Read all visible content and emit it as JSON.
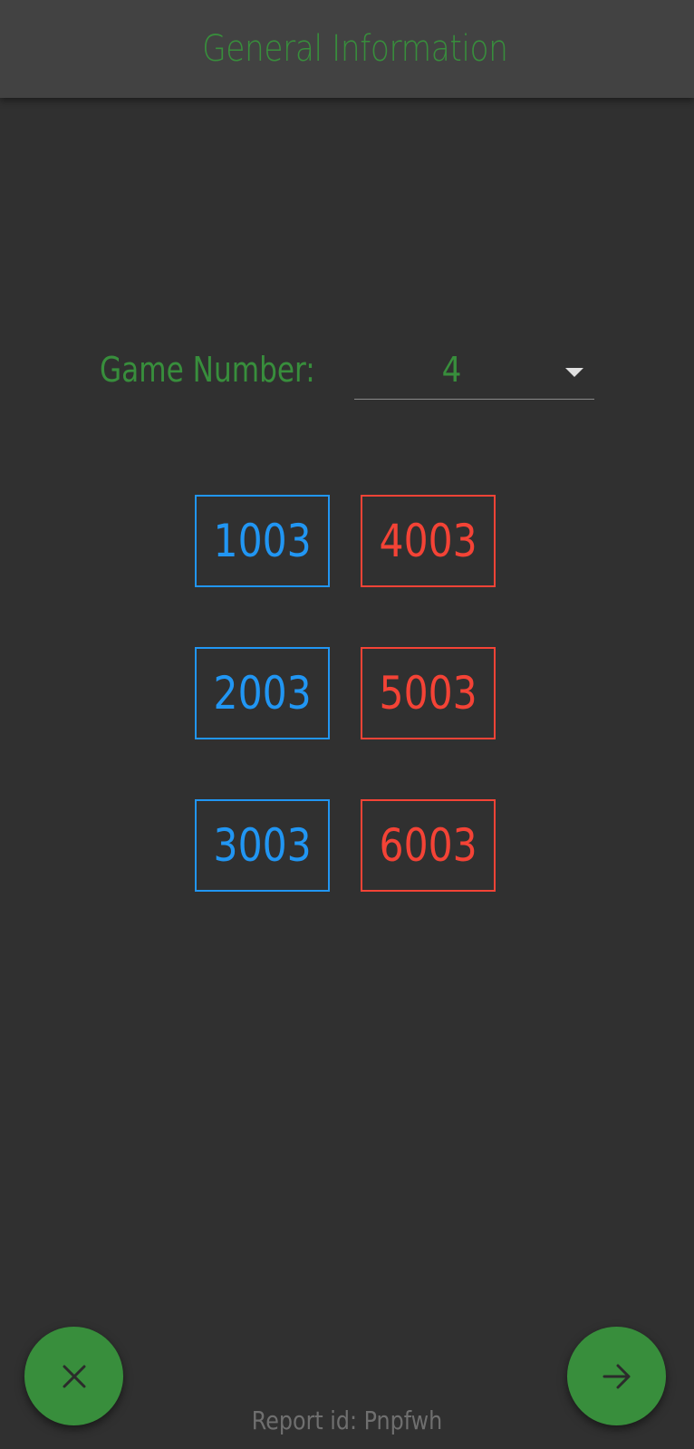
{
  "app_bar": {
    "title": "General Information"
  },
  "game": {
    "label": "Game Number:",
    "selected_value": "4"
  },
  "teams": {
    "blue": [
      "1003",
      "2003",
      "3003"
    ],
    "red": [
      "4003",
      "5003",
      "6003"
    ]
  },
  "footer": {
    "report_id": "Report id: Pnpfwh"
  },
  "icons": {
    "dropdown": "caret-down-icon",
    "close_fab": "close-icon",
    "next_fab": "arrow-right-icon"
  },
  "colors": {
    "accent_green": "#388e3c",
    "blue_alliance": "#2196f3",
    "red_alliance": "#f44336",
    "background": "#303030",
    "app_bar": "#424242"
  }
}
